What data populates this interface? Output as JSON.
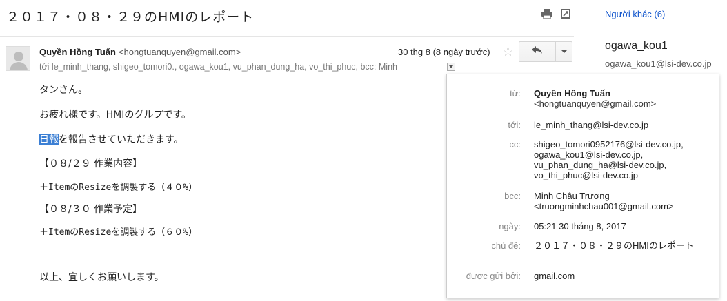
{
  "subject": "２０１７・０８・２９のHMIのレポート",
  "sender": {
    "name": "Quyền Hồng Tuấn",
    "email": "<hongtuanquyen@gmail.com>"
  },
  "date": "30 thg 8 (8 ngày trước)",
  "recipients_line": "tới le_minh_thang, shigeo_tomori0., ogawa_kou1, vu_phan_dung_ha, vo_thi_phuc, bcc: Minh",
  "body": {
    "line1": "タンさん。",
    "line2": "お疲れ様です。HMIのグルプです。",
    "line3_highlight": "日報",
    "line3_rest": "を報告させていただきます。",
    "line4": "【０８/２９ 作業内容】",
    "line5": "＋ItemのResizeを調製する（４０%）",
    "line6": "【０８/３０ 作業予定】",
    "line7": "＋ItemのResizeを調製する（６０%）",
    "line8": "以上、宜しくお願いします。"
  },
  "side": {
    "others_link": "Người khác (6)",
    "contact_name": "ogawa_kou1",
    "contact_email": "ogawa_kou1@lsi-dev.co.jp"
  },
  "details": {
    "from_label": "từ:",
    "from_name": "Quyền Hồng Tuấn",
    "from_email": "<hongtuanquyen@gmail.com>",
    "to_label": "tới:",
    "to_value": "le_minh_thang@lsi-dev.co.jp",
    "cc_label": "cc:",
    "cc_1": "shigeo_tomori0952176@lsi-dev.co.jp,",
    "cc_2": "ogawa_kou1@lsi-dev.co.jp,",
    "cc_3": "vu_phan_dung_ha@lsi-dev.co.jp,",
    "cc_4": "vo_thi_phuc@lsi-dev.co.jp",
    "bcc_label": "bcc:",
    "bcc_name": "Minh Châu Trương",
    "bcc_email": "<truongminhchau001@gmail.com>",
    "date_label": "ngày:",
    "date_value": "05:21 30 tháng 8, 2017",
    "subject_label": "chủ đề:",
    "subject_value": "２０１７・０８・２９のHMIのレポート",
    "mailed_by_label": "được gửi bởi:",
    "mailed_by_value": "gmail.com"
  },
  "icons": {
    "print": "print-icon",
    "new_window": "new-window-icon",
    "star": "star-icon",
    "reply": "reply-icon",
    "more": "chevron-down-icon",
    "details": "chevron-down-icon",
    "avatar": "avatar-icon"
  },
  "colors": {
    "link": "#1155cc",
    "highlight": "#3b7fd4"
  }
}
